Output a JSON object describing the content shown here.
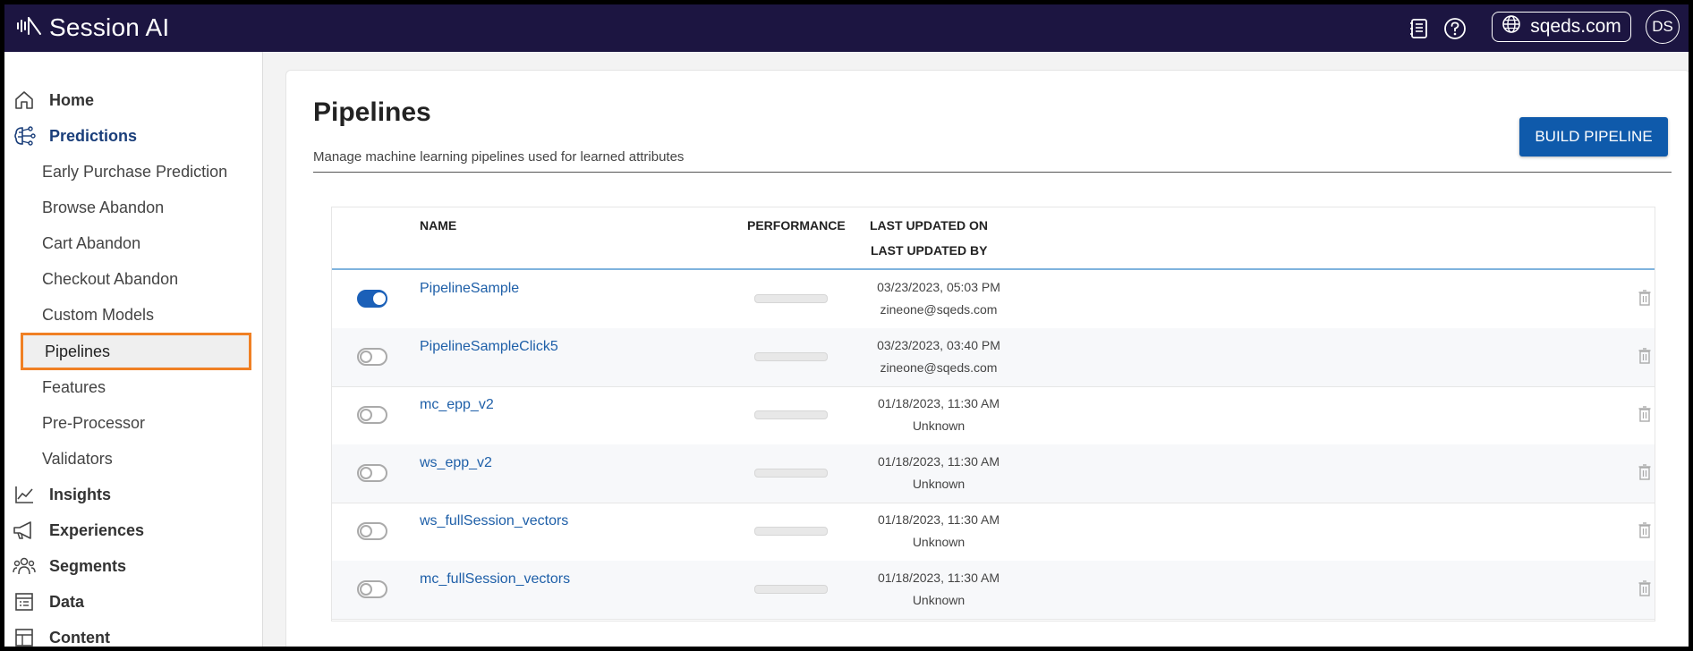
{
  "app": {
    "name": "Session AI",
    "domain": "sqeds.com",
    "user_initials": "DS"
  },
  "sidebar": {
    "top_items": [
      {
        "label": "Home",
        "icon": "home-icon"
      },
      {
        "label": "Predictions",
        "icon": "brain-icon"
      },
      {
        "label": "Insights",
        "icon": "chart-line-icon"
      },
      {
        "label": "Experiences",
        "icon": "megaphone-icon"
      },
      {
        "label": "Segments",
        "icon": "users-icon"
      },
      {
        "label": "Data",
        "icon": "data-table-icon"
      },
      {
        "label": "Content",
        "icon": "layout-icon"
      }
    ],
    "sub_items": [
      "Early Purchase Prediction",
      "Browse Abandon",
      "Cart Abandon",
      "Checkout Abandon",
      "Custom Models",
      "Pipelines",
      "Features",
      "Pre-Processor",
      "Validators"
    ],
    "selected": "Pipelines"
  },
  "page": {
    "title": "Pipelines",
    "subtitle": "Manage machine learning pipelines used for learned attributes",
    "build_button": "BUILD PIPELINE"
  },
  "table": {
    "headers": {
      "name": "NAME",
      "performance": "PERFORMANCE",
      "updated_on": "LAST UPDATED ON",
      "updated_by": "LAST UPDATED BY"
    },
    "rows": [
      {
        "enabled": true,
        "name": "PipelineSample",
        "updated_on": "03/23/2023, 05:03 PM",
        "updated_by": "zineone@sqeds.com"
      },
      {
        "enabled": false,
        "name": "PipelineSampleClick5",
        "updated_on": "03/23/2023, 03:40 PM",
        "updated_by": "zineone@sqeds.com"
      },
      {
        "enabled": false,
        "name": "mc_epp_v2",
        "updated_on": "01/18/2023, 11:30 AM",
        "updated_by": "Unknown"
      },
      {
        "enabled": false,
        "name": "ws_epp_v2",
        "updated_on": "01/18/2023, 11:30 AM",
        "updated_by": "Unknown"
      },
      {
        "enabled": false,
        "name": "ws_fullSession_vectors",
        "updated_on": "01/18/2023, 11:30 AM",
        "updated_by": "Unknown"
      },
      {
        "enabled": false,
        "name": "mc_fullSession_vectors",
        "updated_on": "01/18/2023, 11:30 AM",
        "updated_by": "Unknown"
      }
    ]
  },
  "colors": {
    "topbar": "#1c1541",
    "accent": "#0f5aab",
    "link": "#1e5fa8",
    "highlight": "#f08024"
  }
}
